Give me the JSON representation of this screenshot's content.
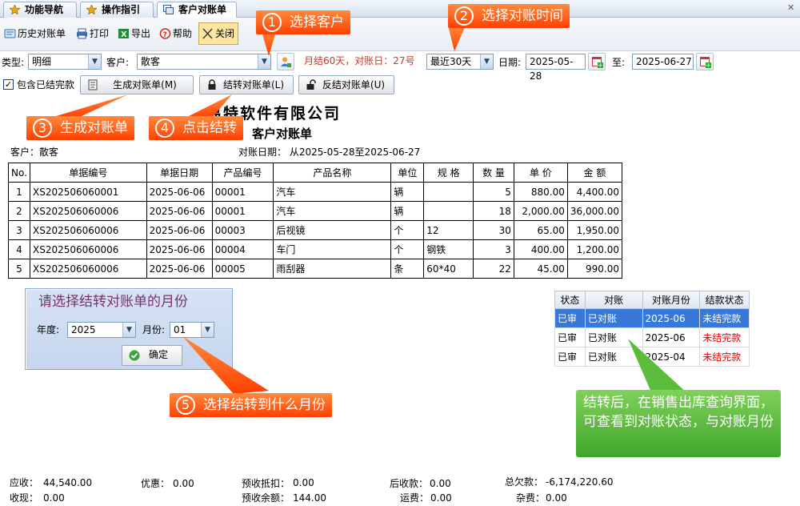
{
  "tabs": [
    {
      "label": "功能导航",
      "icon": "star-icon"
    },
    {
      "label": "操作指引",
      "icon": "star-icon"
    },
    {
      "label": "客户对账单",
      "icon": "window-icon"
    }
  ],
  "toolbar": {
    "history": "历史对账单",
    "print": "打印",
    "export": "导出",
    "help": "帮助",
    "close": "关闭"
  },
  "filters": {
    "type_label": "类型:",
    "type_value": "明细",
    "customer_label": "客户:",
    "customer_value": "散客",
    "terms": "月结60天，对账日：27号",
    "period_value": "最近30天",
    "date_label": "日期:",
    "date_from": "2025-05-28",
    "to_label": "至:",
    "date_to": "2025-06-27"
  },
  "actions": {
    "include_settled": "包含已结完款",
    "generate": "生成对账单(M)",
    "settle": "结转对账单(L)",
    "unsettle": "反结对账单(U)"
  },
  "statement": {
    "company": "易特软件有限公司",
    "title": "客户对账单",
    "customer": "客户：散客",
    "period": "对账日期：  从2025-05-28至2025-06-27",
    "columns": [
      "No.",
      "单据编号",
      "单据日期",
      "产品编号",
      "产品名称",
      "单位",
      "规 格",
      "数 量",
      "单 价",
      "金 额"
    ],
    "rows": [
      [
        "1",
        "XS202506060001",
        "2025-06-06",
        "00001",
        "汽车",
        "辆",
        "",
        "5",
        "880.00",
        "4,400.00"
      ],
      [
        "2",
        "XS202506060006",
        "2025-06-06",
        "00001",
        "汽车",
        "辆",
        "",
        "18",
        "2,000.00",
        "36,000.00"
      ],
      [
        "3",
        "XS202506060006",
        "2025-06-06",
        "00003",
        "后视镜",
        "个",
        "12",
        "30",
        "65.00",
        "1,950.00"
      ],
      [
        "4",
        "XS202506060006",
        "2025-06-06",
        "00004",
        "车门",
        "个",
        "钢铁",
        "3",
        "400.00",
        "1,200.00"
      ],
      [
        "5",
        "XS202506060006",
        "2025-06-06",
        "00005",
        "雨刮器",
        "条",
        "60*40",
        "22",
        "45.00",
        "990.00"
      ]
    ]
  },
  "month_dialog": {
    "title": "请选择结转对账单的月份",
    "year_label": "年度:",
    "year_value": "2025",
    "month_label": "月份:",
    "month_value": "01",
    "ok": "确定"
  },
  "status_table": {
    "columns": [
      "状态",
      "对账",
      "对账月份",
      "结款状态"
    ],
    "rows": [
      [
        "已审",
        "已对账",
        "2025-06",
        "未结完款"
      ],
      [
        "已审",
        "已对账",
        "2025-06",
        "未结完款"
      ],
      [
        "已审",
        "已对账",
        "2025-04",
        "未结完款"
      ]
    ]
  },
  "callouts": [
    {
      "n": "1",
      "text": "选择客户"
    },
    {
      "n": "2",
      "text": "选择对账时间"
    },
    {
      "n": "3",
      "text": "生成对账单"
    },
    {
      "n": "4",
      "text": "点击结转"
    },
    {
      "n": "5",
      "text": "选择结转到什么月份"
    }
  ],
  "note": "结转后，在销售出库查询界面，可查看到对账状态，与对账月份",
  "summary": {
    "ar_label": "应收：",
    "ar": "44,540.00",
    "discount_label": "优惠：",
    "discount": "0.00",
    "prepay_deduct_label": "预收抵扣：",
    "prepay_deduct": "0.00",
    "after_label": "后收款：",
    "after": "0.00",
    "owed_label": "总欠款：",
    "owed": "-6,174,220.60",
    "received_label": "收现：",
    "received": "0.00",
    "prepay_balance_label": "预收余额：",
    "prepay_balance": "144.00",
    "freight_label": "运费：",
    "freight": "0.00",
    "misc_label": "杂费：",
    "misc": "0.00"
  }
}
